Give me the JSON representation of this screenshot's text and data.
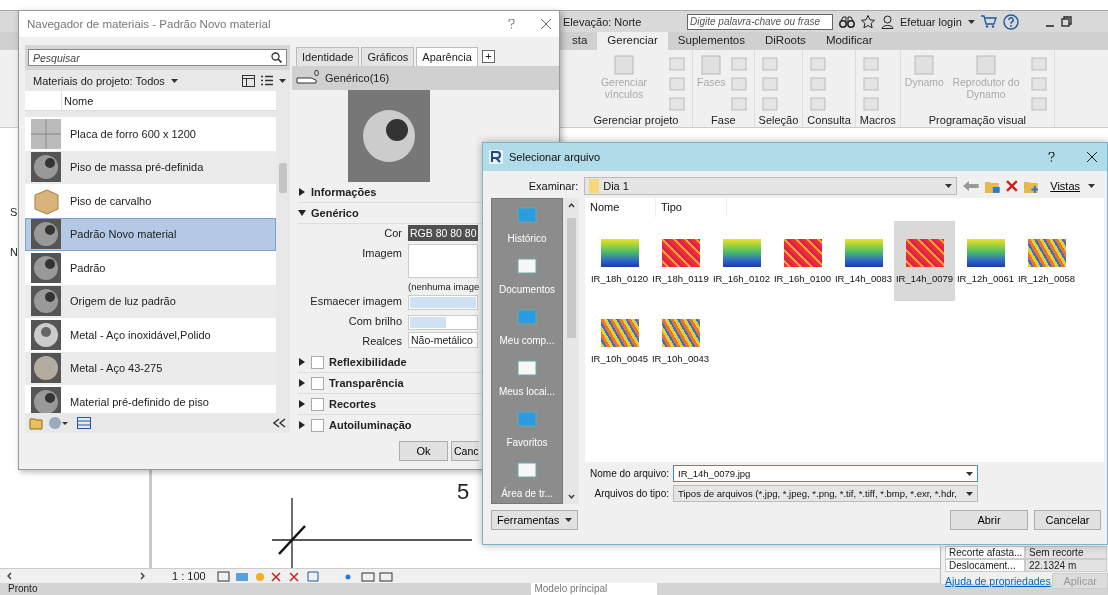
{
  "app": {
    "view_title": "Elevação: Norte",
    "search": {
      "placeholder": "Digite palavra-chave ou frase"
    },
    "login": "Efetuar login",
    "ribbon_tabs": [
      {
        "label": "sta",
        "selected": false
      },
      {
        "label": "Gerenciar",
        "selected": true
      },
      {
        "label": "Suplementos",
        "selected": false
      },
      {
        "label": "DiRoots",
        "selected": false
      },
      {
        "label": "Modificar",
        "selected": false
      }
    ],
    "ribbon_groups": [
      {
        "title": "Gerenciar projeto",
        "buttons": [
          "Gerenciar vínculos"
        ]
      },
      {
        "title": "Fase",
        "buttons": [
          "Fases"
        ]
      },
      {
        "title": "Seleção"
      },
      {
        "title": "Consulta"
      },
      {
        "title": "Macros"
      },
      {
        "title": "Programação visual",
        "buttons": [
          "Dynamo",
          "Reprodutor do Dynamo"
        ]
      }
    ],
    "browser_letters": [
      "S",
      "N"
    ],
    "canvas_label": "5",
    "scale": "1 : 100",
    "properties": {
      "rows": [
        {
          "name": "Recorte afasta...",
          "value": "Sem recorte"
        },
        {
          "name": "Deslocament...",
          "value": "22.1324 m"
        }
      ],
      "help_link": "Ajuda de propriedades",
      "apply_button": "Aplicar"
    },
    "status_text": "Pronto",
    "model_field": "Modelo principal"
  },
  "material_browser": {
    "title": "Navegador de materiais - Padrão Novo material",
    "search": {
      "placeholder": "Pesquisar"
    },
    "filter": "Materiais do projeto: Todos",
    "column": "Nome",
    "materials": [
      {
        "name": "Placa de forro 600 x 1200",
        "kind": "grid",
        "selected": false
      },
      {
        "name": "Piso de massa pré-definida",
        "kind": "sphere",
        "selected": false
      },
      {
        "name": "Piso de carvalho",
        "kind": "wood",
        "selected": false
      },
      {
        "name": "Padrão Novo material",
        "kind": "sphere",
        "selected": true
      },
      {
        "name": "Padrão",
        "kind": "sphere",
        "selected": false
      },
      {
        "name": "Origem de luz padrão",
        "kind": "sphere",
        "selected": false
      },
      {
        "name": "Metal - Aço inoxidável,Polido",
        "kind": "chrome",
        "selected": false
      },
      {
        "name": "Metal - Aço 43-275",
        "kind": "matte",
        "selected": false
      },
      {
        "name": "Material pré-definido de piso",
        "kind": "sphere",
        "selected": false
      }
    ],
    "tabs": [
      {
        "label": "Identidade",
        "selected": false
      },
      {
        "label": "Gráficos",
        "selected": false
      },
      {
        "label": "Aparência",
        "selected": true
      }
    ],
    "add_tab": "+",
    "asset": {
      "name": "Genérico(16)",
      "count": "0"
    },
    "sections": [
      {
        "label": "Informações",
        "kind": "plain",
        "expanded": false
      },
      {
        "label": "Genérico",
        "kind": "plain",
        "expanded": true,
        "properties": [
          {
            "label": "Cor",
            "kind": "color",
            "value": "RGB 80 80 80"
          },
          {
            "label": "Imagem",
            "kind": "image",
            "caption": "(nenhuma image"
          },
          {
            "label": "Esmaecer imagem",
            "kind": "slider",
            "level": 1
          },
          {
            "label": "Com brilho",
            "kind": "slider",
            "level": 0.55
          },
          {
            "label": "Realces",
            "kind": "select",
            "value": "Não-metálico"
          }
        ]
      },
      {
        "label": "Reflexibilidade",
        "kind": "toggle",
        "expanded": false,
        "checked": false
      },
      {
        "label": "Transparência",
        "kind": "toggle",
        "expanded": false,
        "checked": false
      },
      {
        "label": "Recortes",
        "kind": "toggle",
        "expanded": false,
        "checked": false
      },
      {
        "label": "Autoiluminação",
        "kind": "toggle",
        "expanded": false,
        "checked": false
      }
    ],
    "buttons": [
      "Ok",
      "Canc"
    ]
  },
  "file_dialog": {
    "title": "Selecionar arquivo",
    "look_in_label": "Examinar:",
    "folder": "Dia 1",
    "views_button": "Vistas",
    "places": [
      "Histórico",
      "Documentos",
      "Meu comp...",
      "Meus locai...",
      "Favoritos",
      "Área de tr..."
    ],
    "columns": [
      "Nome",
      "Tipo"
    ],
    "files": [
      {
        "name": "IR_18h_0120",
        "kind": "cool",
        "selected": false
      },
      {
        "name": "IR_18h_0119",
        "kind": "hot",
        "selected": false
      },
      {
        "name": "IR_16h_0102",
        "kind": "cool",
        "selected": false
      },
      {
        "name": "IR_16h_0100",
        "kind": "hot",
        "selected": false
      },
      {
        "name": "IR_14h_0083",
        "kind": "cool",
        "selected": false
      },
      {
        "name": "IR_14h_0079",
        "kind": "hot",
        "selected": true
      },
      {
        "name": "IR_12h_0061",
        "kind": "cool",
        "selected": false
      },
      {
        "name": "IR_12h_0058",
        "kind": "mixed",
        "selected": false
      },
      {
        "name": "IR_10h_0045",
        "kind": "mixed",
        "selected": false
      },
      {
        "name": "IR_10h_0043",
        "kind": "mixed",
        "selected": false
      }
    ],
    "file_name": {
      "label": "Nome do arquivo:",
      "value": "IR_14h_0079.jpg"
    },
    "file_type": {
      "label": "Arquivos do tipo:",
      "value": "Tipos de arquivos (*.jpg, *.jpeg, *.png, *.tif, *.tiff, *.bmp, *.exr, *.hdr,"
    },
    "tools_button": "Ferramentas",
    "buttons": [
      "Abrir",
      "Cancelar"
    ]
  }
}
